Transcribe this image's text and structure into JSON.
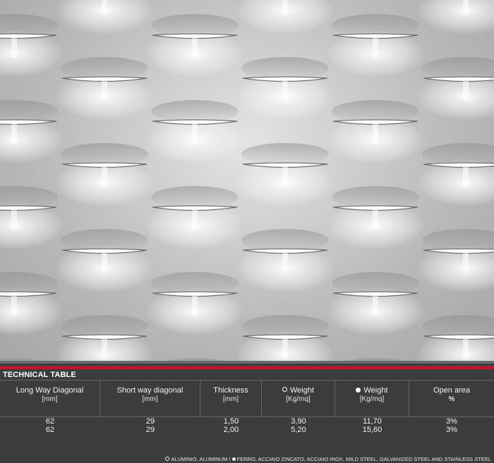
{
  "table": {
    "title": "TECHNICAL TABLE",
    "columns": [
      {
        "label": "Long Way Diagonal",
        "unit": "[mm]"
      },
      {
        "label": "Short way diagonal",
        "unit": "[mm]"
      },
      {
        "label": "Thickness",
        "unit": "[mm]"
      },
      {
        "label": "Weight",
        "unit": "[Kg/mq]",
        "marker": "open-circle"
      },
      {
        "label": "Weight",
        "unit": "[Kg/mq]",
        "marker": "filled-circle"
      },
      {
        "label": "Open area",
        "unit": "%"
      }
    ],
    "rows": [
      [
        "62",
        "29",
        "1,50",
        "3,90",
        "11,70",
        "3%"
      ],
      [
        "62",
        "29",
        "2,00",
        "5,20",
        "15,60",
        "3%"
      ]
    ]
  },
  "footnote": {
    "aluminum": "ALUMINIO, ALUMINUM /",
    "steel": "FERRO, ACCIAIO ZINCATO, ACCIAIO INOX, MILD STEEL, GALVANIZED STEEL AND STAINLESS STEEL"
  },
  "colors": {
    "accent_red": "#d10a2f",
    "table_bg": "#3c3c3c",
    "text": "#f2f2f2"
  }
}
